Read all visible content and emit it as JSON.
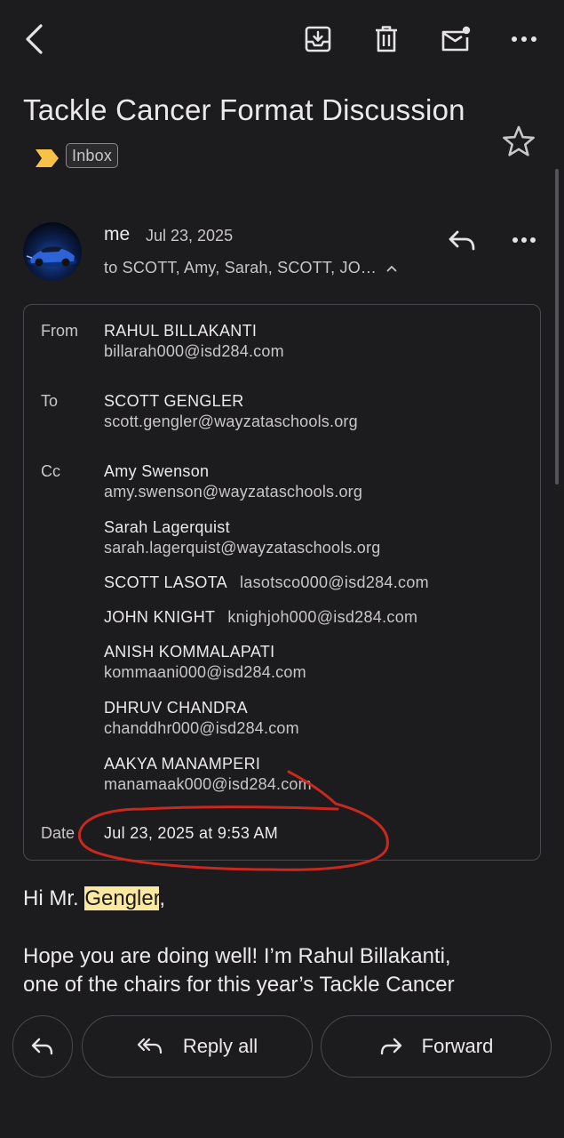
{
  "toolbar": {
    "back_icon": "chevron-left-icon",
    "archive_icon": "archive-icon",
    "delete_icon": "trash-icon",
    "unread_icon": "mark-unread-icon",
    "more_icon": "more-horiz-icon"
  },
  "subject": {
    "title": "Tackle Cancer Format Discussion",
    "label": "Inbox",
    "importance_color": "#f7c247"
  },
  "message": {
    "sender": "me",
    "date": "Jul 23, 2025",
    "recipients_summary": "to SCOTT, Amy, Sarah, SCOTT, JO…",
    "details": {
      "from_label": "From",
      "from_name": "RAHUL BILLAKANTI",
      "from_email": "billarah000@isd284.com",
      "to_label": "To",
      "to_name": "SCOTT GENGLER",
      "to_email": "scott.gengler@wayzataschools.org",
      "cc_label": "Cc",
      "cc": [
        {
          "name": "Amy Swenson",
          "email": "amy.swenson@wayzataschools.org"
        },
        {
          "name": "Sarah Lagerquist",
          "email": "sarah.lagerquist@wayzataschools.org"
        },
        {
          "name": "SCOTT LASOTA",
          "email": "lasotsco000@isd284.com"
        },
        {
          "name": "JOHN KNIGHT",
          "email": "knighjoh000@isd284.com"
        },
        {
          "name": "ANISH KOMMALAPATI",
          "email": "kommaani000@isd284.com"
        },
        {
          "name": "DHRUV CHANDRA",
          "email": "chanddhr000@isd284.com"
        },
        {
          "name": "AAKYA MANAMPERI",
          "email": "manamaak000@isd284.com"
        }
      ],
      "date_label": "Date",
      "date_value": "Jul 23, 2025 at 9:53 AM"
    },
    "greeting_prefix": "Hi Mr. ",
    "greeting_name": "Gengler",
    "greeting_suffix": ",",
    "body_line1": "Hope you are doing well! I’m Rahul Billakanti,",
    "body_line2": "one of the chairs for this year’s Tackle Cancer"
  },
  "actions": {
    "reply_icon": "reply-icon",
    "reply_all_label": "Reply all",
    "forward_label": "Forward"
  },
  "annotation_color": "#c8281e"
}
